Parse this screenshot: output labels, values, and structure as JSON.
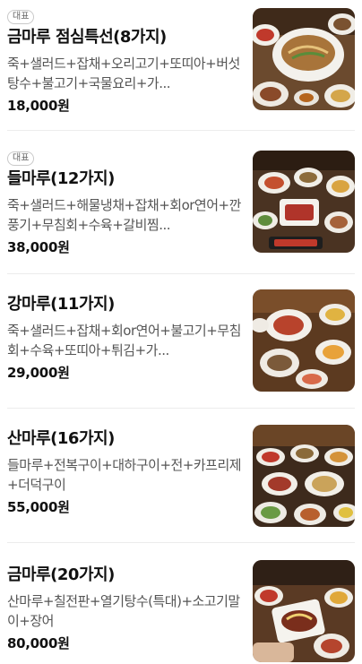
{
  "menu": {
    "items": [
      {
        "badge": "대표",
        "name": "금마루 점심특선(8가지)",
        "description": "죽+샐러드+잡채+오리고기+또띠아+버섯탕수+불고기+국물요리+가...",
        "price": "18,000원",
        "image_icon": "food-photo-icon"
      },
      {
        "badge": "대표",
        "name": "들마루(12가지)",
        "description": "죽+샐러드+해물냉채+잡채+회or연어+깐풍기+무침회+수육+갈비찜...",
        "price": "38,000원",
        "image_icon": "food-photo-icon"
      },
      {
        "badge": "",
        "name": "강마루(11가지)",
        "description": "죽+샐러드+잡채+회or연어+불고기+무침회+수육+또띠아+튀김+가...",
        "price": "29,000원",
        "image_icon": "food-photo-icon"
      },
      {
        "badge": "",
        "name": "산마루(16가지)",
        "description": "들마루+전복구이+대하구이+전+카프리제+더덕구이",
        "price": "55,000원",
        "image_icon": "food-photo-icon"
      },
      {
        "badge": "",
        "name": "금마루(20가지)",
        "description": "산마루+칠전판+열기탕수(특대)+소고기말이+장어",
        "price": "80,000원",
        "image_icon": "food-photo-icon"
      }
    ]
  },
  "colors": {
    "background": "#ffffff",
    "text_primary": "#111111",
    "text_secondary": "#555555",
    "divider": "#ececec",
    "badge_border": "#c9c9c9"
  }
}
